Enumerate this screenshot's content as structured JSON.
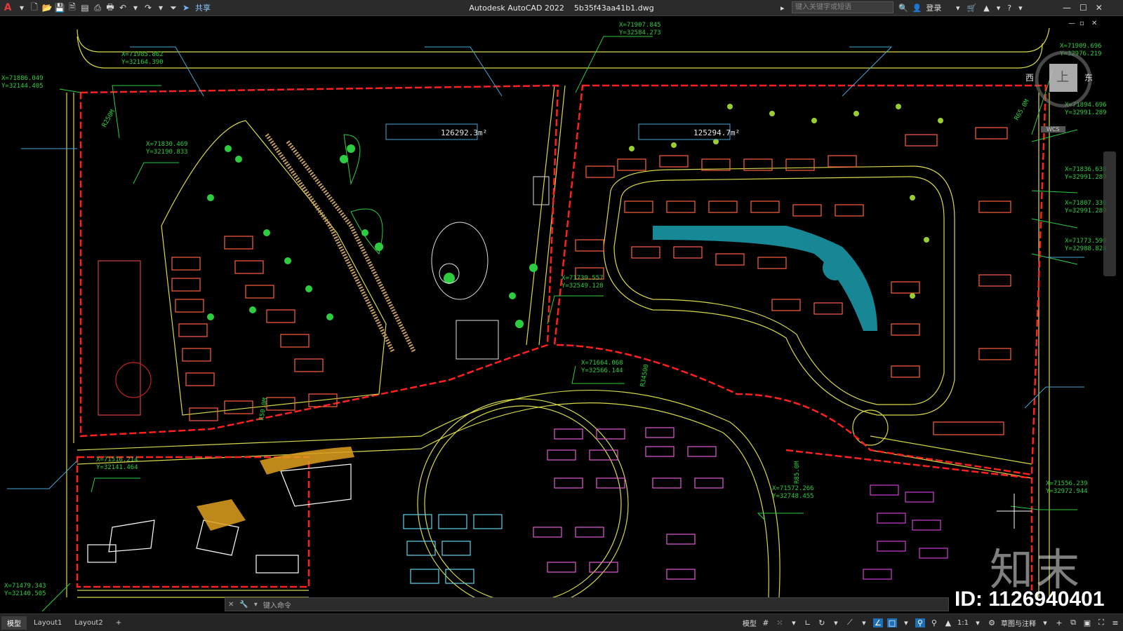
{
  "app": {
    "name": "Autodesk AutoCAD 2022",
    "file": "5b35f43aa41b1.dwg",
    "logo": "A"
  },
  "toolbar": {
    "share_label": "共享"
  },
  "search": {
    "placeholder": "键入关键字或短语"
  },
  "user": {
    "login_label": "登录"
  },
  "viewcube": {
    "top": "上",
    "west": "西",
    "east": "东",
    "wcs": "WCS"
  },
  "drawing": {
    "areas": [
      "126292.3m²",
      "125294.7m²"
    ],
    "coords": [
      {
        "x": "X=71907.845",
        "y": "Y=32584.273"
      },
      {
        "x": "X=71985.862",
        "y": "Y=32164.390"
      },
      {
        "x": "X=71886.049",
        "y": "Y=32144.405"
      },
      {
        "x": "X=71830.469",
        "y": "Y=32190.833"
      },
      {
        "x": "X=71909.696",
        "y": "Y=32976.219"
      },
      {
        "x": "X=71894.696",
        "y": "Y=32991.289"
      },
      {
        "x": "X=71836.638",
        "y": "Y=32991.289"
      },
      {
        "x": "X=71807.336",
        "y": "Y=32991.289"
      },
      {
        "x": "X=71773.590",
        "y": "Y=32988.824"
      },
      {
        "x": "X=71739.557",
        "y": "Y=32549.128"
      },
      {
        "x": "X=71664.068",
        "y": "Y=32566.144"
      },
      {
        "x": "X=71572.266",
        "y": "Y=32748.455"
      },
      {
        "x": "X=71556.239",
        "y": "Y=32972.944"
      },
      {
        "x": "X=71516.214",
        "y": "Y=32141.464"
      },
      {
        "x": "X=71479.343",
        "y": "Y=32140.505"
      }
    ],
    "radius_labels": [
      "R250M",
      "R34500",
      "R50.0M",
      "R65.0M",
      "R85.0M"
    ]
  },
  "command": {
    "placeholder": "键入命令"
  },
  "layouts": {
    "tabs": [
      "模型",
      "Layout1",
      "Layout2"
    ],
    "active": "模型",
    "add": "+"
  },
  "status": {
    "model": "模型",
    "scale": "1:1",
    "workspace": "草图与注释"
  },
  "watermark": {
    "logo": "知末",
    "id": "ID: 1126940401"
  }
}
